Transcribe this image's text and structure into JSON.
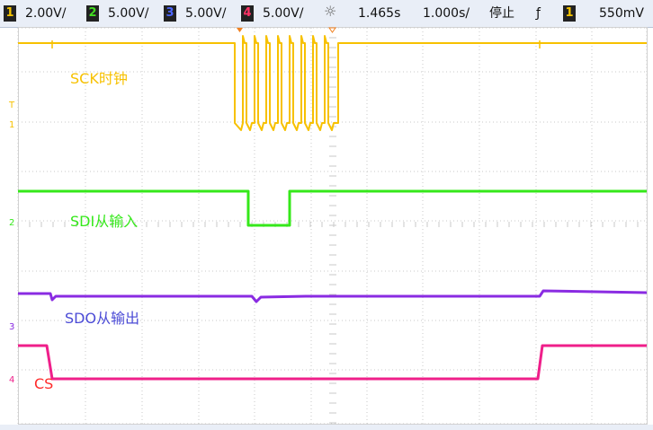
{
  "status_bar": {
    "ch1": {
      "num": "1",
      "scale": "2.00V/",
      "box_bg": "#f5c400"
    },
    "ch2": {
      "num": "2",
      "scale": "5.00V/",
      "box_bg": "#44dd22"
    },
    "ch3": {
      "num": "3",
      "scale": "5.00V/",
      "box_bg": "#4d66ff"
    },
    "ch4": {
      "num": "4",
      "scale": "5.00V/",
      "box_bg": "#ff3366"
    },
    "trigger_icon": "sun-burst-icon",
    "time_position": "1.465s",
    "time_scale": "1.000s/",
    "run_state": "停止",
    "trigger_edge_icon": "rising-edge-icon",
    "trig_channel": "1",
    "trig_level": "550mV"
  },
  "waveform_labels": {
    "sck": "SCK时钟",
    "sdi": "SDI从输入",
    "sdo": "SDO从输出",
    "cs": "CS"
  },
  "channel_markers": {
    "ch1": "1",
    "ch2": "2",
    "ch3": "3",
    "ch4": "4",
    "trigger": "T"
  },
  "colors": {
    "sck": "#f7c100",
    "sdi": "#35e81a",
    "sdo": "#8a2be2",
    "cs": "#ef1f8a",
    "grid": "#c9c9c9",
    "label_sdo": "#4b4bd6",
    "label_cs": "#ff2a2a"
  }
}
